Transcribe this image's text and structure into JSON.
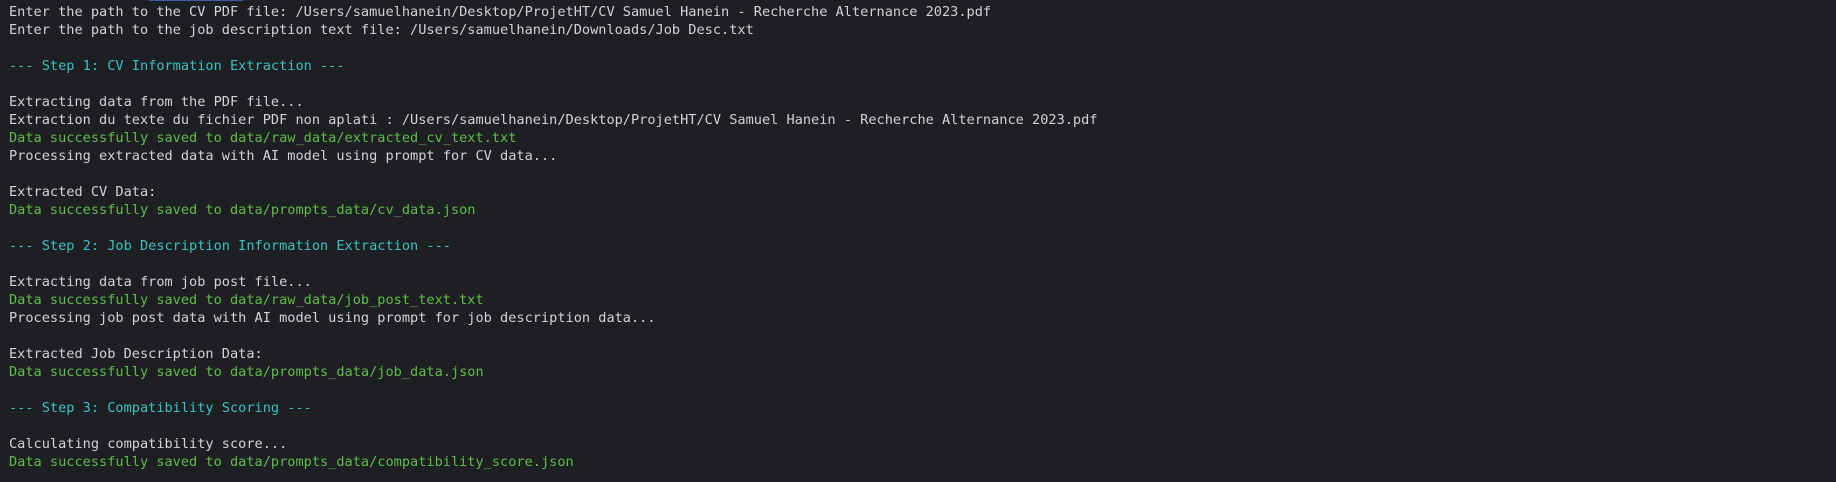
{
  "console": {
    "lines": [
      {
        "text": "Enter the path to the CV PDF file: /Users/samuelhanein/Desktop/ProjetHT/CV Samuel Hanein - Recherche Alternance 2023.pdf",
        "style": "default"
      },
      {
        "text": "Enter the path to the job description text file: /Users/samuelhanein/Downloads/Job Desc.txt",
        "style": "default"
      },
      {
        "text": "",
        "style": "default"
      },
      {
        "text": "--- Step 1: CV Information Extraction ---",
        "style": "header"
      },
      {
        "text": "",
        "style": "default"
      },
      {
        "text": "Extracting data from the PDF file...",
        "style": "default"
      },
      {
        "text": "Extraction du texte du fichier PDF non aplati : /Users/samuelhanein/Desktop/ProjetHT/CV Samuel Hanein - Recherche Alternance 2023.pdf",
        "style": "default"
      },
      {
        "text": "Data successfully saved to data/raw_data/extracted_cv_text.txt",
        "style": "success"
      },
      {
        "text": "Processing extracted data with AI model using prompt for CV data...",
        "style": "default"
      },
      {
        "text": "",
        "style": "default"
      },
      {
        "text": "Extracted CV Data:",
        "style": "default"
      },
      {
        "text": "Data successfully saved to data/prompts_data/cv_data.json",
        "style": "success"
      },
      {
        "text": "",
        "style": "default"
      },
      {
        "text": "--- Step 2: Job Description Information Extraction ---",
        "style": "header"
      },
      {
        "text": "",
        "style": "default"
      },
      {
        "text": "Extracting data from job post file...",
        "style": "default"
      },
      {
        "text": "Data successfully saved to data/raw_data/job_post_text.txt",
        "style": "success"
      },
      {
        "text": "Processing job post data with AI model using prompt for job description data...",
        "style": "default"
      },
      {
        "text": "",
        "style": "default"
      },
      {
        "text": "Extracted Job Description Data:",
        "style": "default"
      },
      {
        "text": "Data successfully saved to data/prompts_data/job_data.json",
        "style": "success"
      },
      {
        "text": "",
        "style": "default"
      },
      {
        "text": "--- Step 3: Compatibility Scoring ---",
        "style": "header"
      },
      {
        "text": "",
        "style": "default"
      },
      {
        "text": "Calculating compatibility score...",
        "style": "default"
      },
      {
        "text": "Data successfully saved to data/prompts_data/compatibility_score.json",
        "style": "success"
      }
    ]
  },
  "colors": {
    "background": "#1e1f22",
    "default_text": "#d1d3d8",
    "success_text": "#5fbd48",
    "header_text": "#38c2c2"
  }
}
